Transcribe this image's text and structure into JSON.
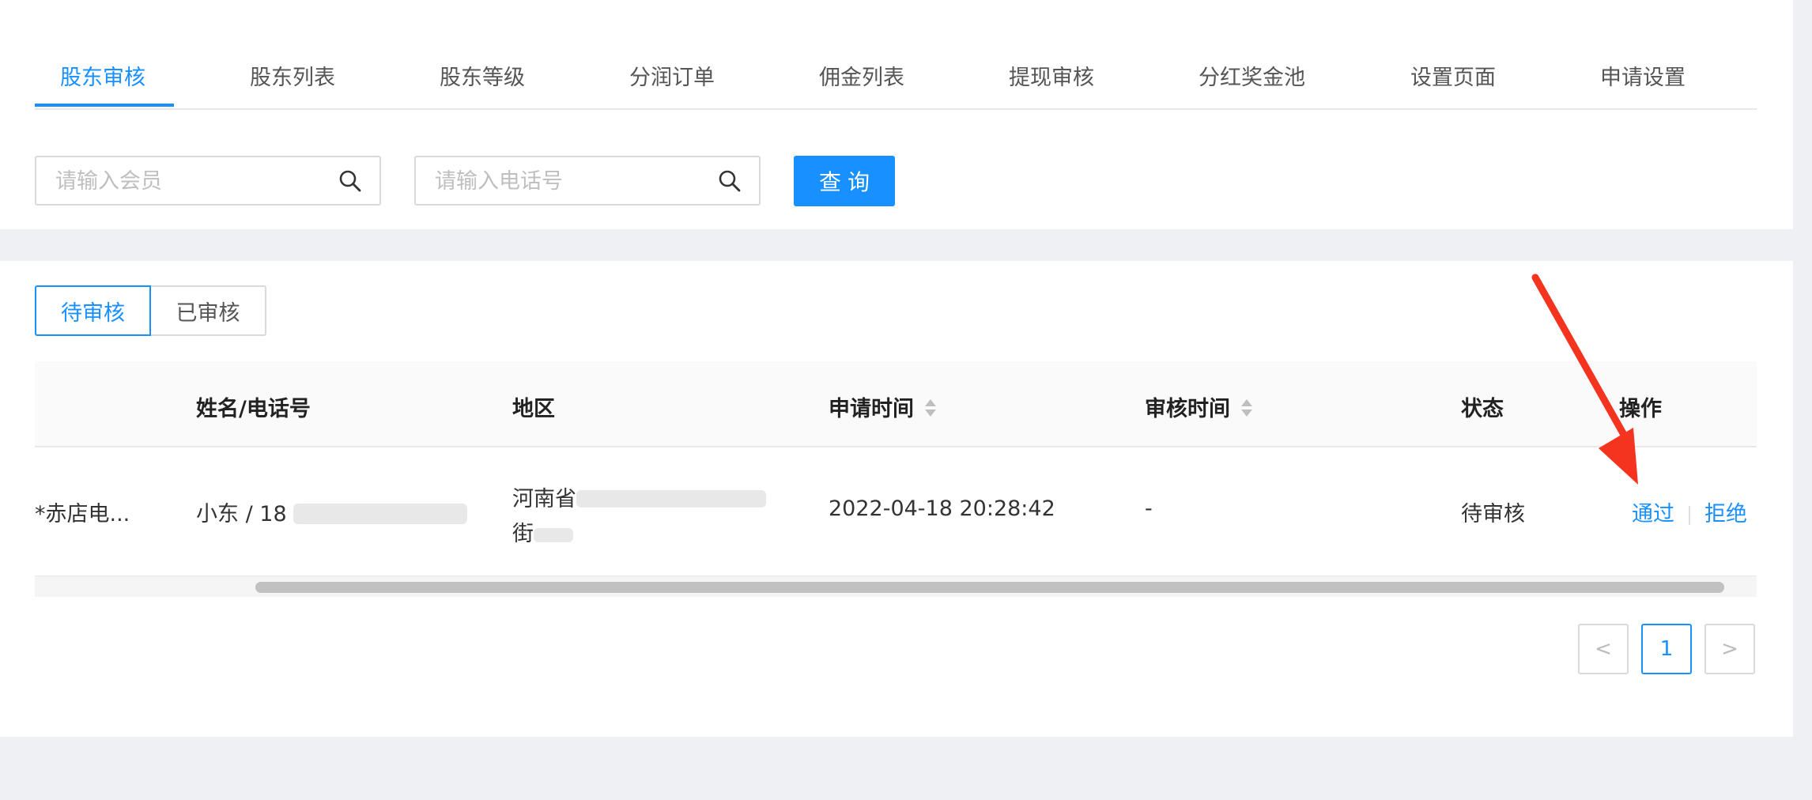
{
  "tabs": [
    {
      "label": "股东审核",
      "active": true
    },
    {
      "label": "股东列表"
    },
    {
      "label": "股东等级"
    },
    {
      "label": "分润订单"
    },
    {
      "label": "佣金列表"
    },
    {
      "label": "提现审核"
    },
    {
      "label": "分红奖金池"
    },
    {
      "label": "设置页面"
    },
    {
      "label": "申请设置"
    }
  ],
  "search": {
    "member_placeholder": "请输入会员",
    "phone_placeholder": "请输入电话号",
    "query_label": "查询"
  },
  "status_filter": {
    "pending_label": "待审核",
    "reviewed_label": "已审核",
    "selected": "待审核"
  },
  "table": {
    "columns": {
      "name_phone": "姓名/电话号",
      "region": "地区",
      "apply_time": "申请时间",
      "review_time": "审核时间",
      "status": "状态",
      "actions": "操作"
    },
    "rows": [
      {
        "store": "*赤店电...",
        "name_phone": "小东 / 18",
        "region": "河南省",
        "region_line2": "街",
        "apply_time": "2022-04-18 20:28:42",
        "review_time": "-",
        "status": "待审核",
        "approve_label": "通过",
        "reject_label": "拒绝"
      }
    ]
  },
  "pagination": {
    "prev": "<",
    "current": "1",
    "next": ">"
  },
  "colors": {
    "primary": "#1890ff",
    "annotation_arrow": "#f5341f"
  }
}
